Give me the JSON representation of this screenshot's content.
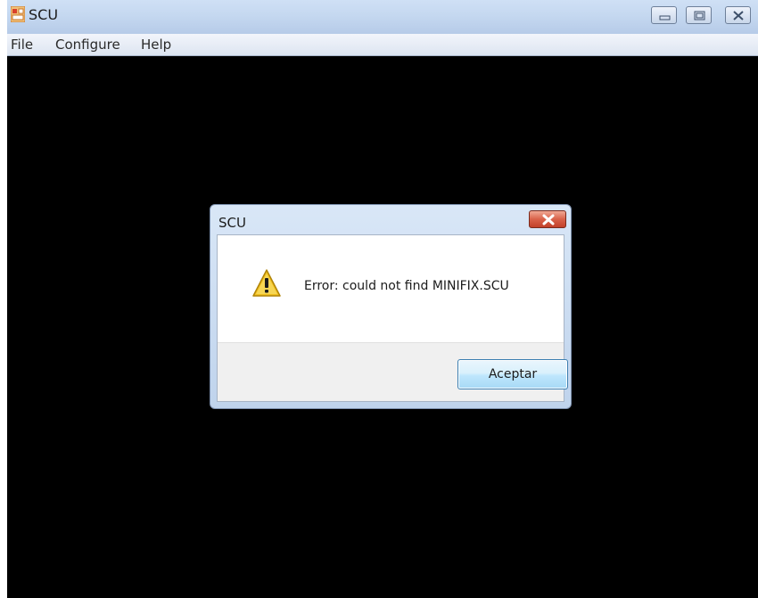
{
  "window": {
    "title": "SCU",
    "icon": "app-icon",
    "controls": [
      "minimize-icon",
      "maximize-icon",
      "close-icon"
    ]
  },
  "menu": {
    "items": [
      {
        "label": "File"
      },
      {
        "label": "Configure"
      },
      {
        "label": "Help"
      }
    ]
  },
  "dialog": {
    "title": "SCU",
    "icon": "warning-icon",
    "message": "Error: could not find MINIFIX.SCU",
    "ok_label": "Aceptar"
  },
  "colors": {
    "workspace": "#000000",
    "titlebar": "#c5d8f0",
    "dialog_close": "#d9624a",
    "warning": "#f2c01e"
  }
}
